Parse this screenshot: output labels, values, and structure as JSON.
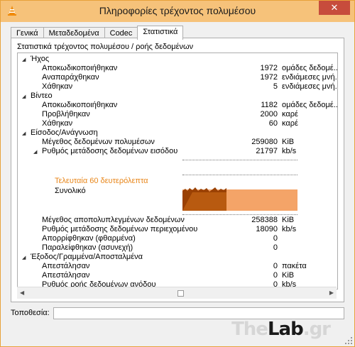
{
  "window": {
    "title": "Πληροφορίες τρέχοντος πολυμέσου",
    "close": "✕"
  },
  "tabs": [
    "Γενικά",
    "Μεταδεδομένα",
    "Codec",
    "Στατιστικά"
  ],
  "panel": {
    "heading": "Στατιστικά τρέχοντος πολυμέσου / ροής δεδομένων",
    "groups": {
      "audio": {
        "label": "Ήχος",
        "rows": [
          {
            "label": "Αποκωδικοποιήθηκαν",
            "value": "1972",
            "unit": "ομάδες δεδομέ..."
          },
          {
            "label": "Αναπαράχθηκαν",
            "value": "1972",
            "unit": "ενδιάμεσες μνή..."
          },
          {
            "label": "Χάθηκαν",
            "value": "5",
            "unit": "ενδιάμεσες μνή..."
          }
        ]
      },
      "video": {
        "label": "Βίντεο",
        "rows": [
          {
            "label": "Αποκωδικοποιήθηκαν",
            "value": "1182",
            "unit": "ομάδες δεδομέ..."
          },
          {
            "label": "Προβλήθηκαν",
            "value": "2000",
            "unit": "καρέ"
          },
          {
            "label": "Χάθηκαν",
            "value": "60",
            "unit": "καρέ"
          }
        ]
      },
      "input": {
        "label": "Είσοδος/Ανάγνωση",
        "rows": [
          {
            "label": "Μέγεθος δεδομένων πολυμέσων",
            "value": "259080",
            "unit": "KiB"
          }
        ],
        "rate": {
          "label": "Ρυθμός μετάδοσης δεδομένων εισόδου",
          "value": "21797",
          "unit": "kb/s"
        },
        "graph": {
          "last60": "Τελευταία 60 δευτερόλεπτα",
          "total": "Συνολικό",
          "last60_color": "#e8861a"
        },
        "rows2": [
          {
            "label": "Μέγεθος αποπολυπλεγμένων δεδομένων",
            "value": "258388",
            "unit": "KiB"
          },
          {
            "label": "Ρυθμός μετάδοσης δεδομένων περιεχομένου",
            "value": "18090",
            "unit": "kb/s"
          },
          {
            "label": "Απορρίφθηκαν (φθαρμένα)",
            "value": "0",
            "unit": ""
          },
          {
            "label": "Παραλείφθηκαν (ασυνεχή)",
            "value": "0",
            "unit": ""
          }
        ]
      },
      "output": {
        "label": "Έξοδος/Γραμμένα/Αποσταλμένα",
        "rows": [
          {
            "label": "Απεστάλησαν",
            "value": "0",
            "unit": "πακέτα"
          },
          {
            "label": "Απεστάλησαν",
            "value": "0",
            "unit": "KiB"
          },
          {
            "label": "Ρυθμός ροής δεδομένων ανόδου",
            "value": "0",
            "unit": "kb/s"
          }
        ]
      }
    }
  },
  "location": {
    "label": "Τοποθεσία:",
    "value": ""
  },
  "watermark": {
    "a": "The",
    "b": "Lab",
    "c": ".gr"
  }
}
